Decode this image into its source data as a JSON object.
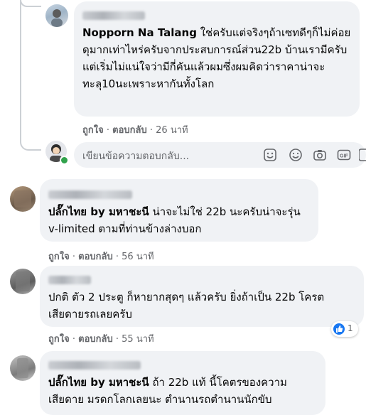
{
  "comments": [
    {
      "mention": "Nopporn Na Talang",
      "text": " ใช่ครับแต่จริงๆถ้าเซทดีๆก็ไม่ค่อยดุมากเท่าไหร่ครับจากประสบการณ์ส่วน22b บ้านเรามีครับแต่เริ่มไม่แน่ใจว่ามีกี่คันแล้วผมซึ่งผมคิดว่าราคาน่าจะทะลุ10นะเพราะหากันทั้งโลก",
      "like_label": "ถูกใจ",
      "reply_label": "ตอบกลับ",
      "time": "26 นาที"
    },
    {
      "mention": "ปลั๊กไทย by มหาชะนี",
      "text": " น่าจะไม่ใช่ 22b นะครับน่าจะรุ่น v-limited ตามที่ท่านข้างล่างบอก",
      "like_label": "ถูกใจ",
      "reply_label": "ตอบกลับ",
      "time": "56 นาที"
    },
    {
      "mention": "",
      "text": "ปกติ ตัว 2 ประตู ก็หายากสุดๆ แล้วครับ ยิ่งถ้าเป็น 22b โครตเสียดายรถเลยครับ",
      "like_label": "ถูกใจ",
      "reply_label": "ตอบกลับ",
      "time": "55 นาที",
      "reaction_count": "1"
    },
    {
      "mention": "ปลั๊กไทย by มหาชะนี",
      "text": " ถ้า 22b แท้ นี้โคตรของความเสียดาย มรดกโลกเลยนะ ตำนานรถตำนานนักขับ"
    }
  ],
  "reply_box": {
    "placeholder": "เขียนข้อความตอบกลับ..."
  },
  "separator": "·",
  "icons": [
    "sticker-icon",
    "emoji-icon",
    "camera-icon",
    "gif-icon",
    "attach-sticker-icon"
  ],
  "colors": {
    "bubble": "#f0f2f5",
    "meta_text": "#65676b",
    "like_blue": "#1877f2",
    "online_green": "#31a24c"
  }
}
